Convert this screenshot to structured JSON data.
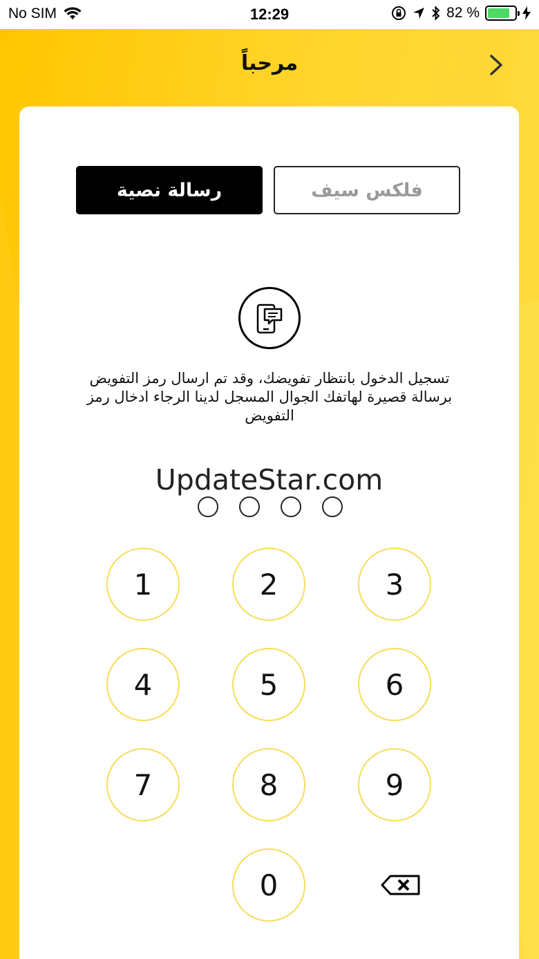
{
  "status_bar": {
    "carrier": "No SIM",
    "time": "12:29",
    "battery_percent": "82 %",
    "battery_level": 0.82
  },
  "header": {
    "title": "مرحباً"
  },
  "tabs": {
    "sms_label": "رسالة نصية",
    "flex_label": "فلكس سيف"
  },
  "message": "تسجيل الدخول بانتظار تفويضك، وقد تم ارسال رمز التفويض برسالة قصيرة لهاتفك الجوال المسجل لدينا الرجاء ادخال رمز التفويض",
  "watermark": "UpdateStar.com",
  "keypad": {
    "keys": [
      "1",
      "2",
      "3",
      "4",
      "5",
      "6",
      "7",
      "8",
      "9",
      "0"
    ]
  },
  "colors": {
    "accent_yellow": "#ffd21e",
    "key_border": "#f7dc5a",
    "battery_green": "#4cd964"
  }
}
